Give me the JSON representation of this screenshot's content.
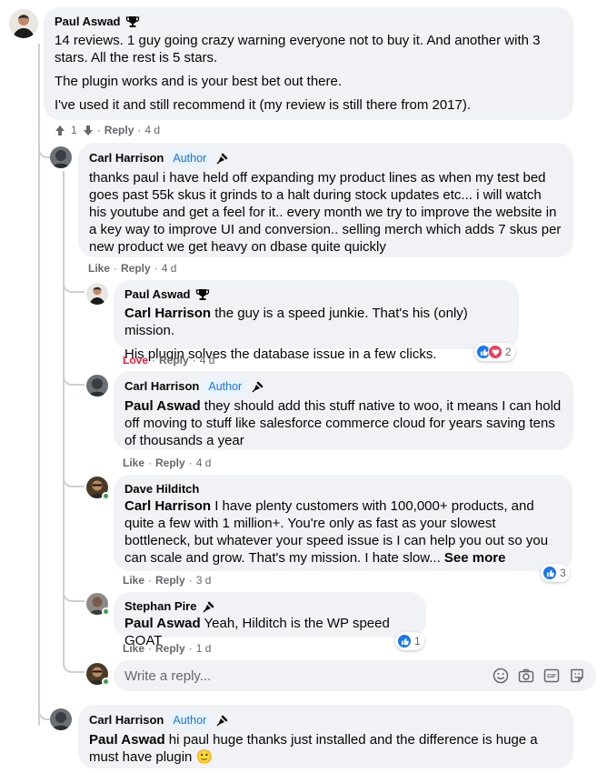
{
  "comments": {
    "c1": {
      "author": "Paul Aswad",
      "paragraphs": [
        "14 reviews. 1 guy going crazy warning everyone not to buy it. And another with 3 stars. All the rest is 5 stars.",
        "The plugin works and is your best bet out there.",
        "I've used it and still recommend it (my review is still there from 2017)."
      ],
      "votes": "1",
      "reply_label": "Reply",
      "time": "4 d"
    },
    "c2": {
      "author": "Carl Harrison",
      "badge": "Author",
      "text": "thanks paul i have held off expanding my product lines as when my test bed goes past 55k skus it grinds to a halt during stock updates etc... i will watch his youtube and get a feel for it.. every month we try to improve the website in a key way to improve UI and conversion.. selling merch which adds 7 skus per new product we get heavy on dbase quite quickly",
      "like_label": "Like",
      "reply_label": "Reply",
      "time": "4 d"
    },
    "c3": {
      "author": "Paul Aswad",
      "mention": "Carl Harrison",
      "text": " the guy is a speed junkie. That's his (only) mission.",
      "text2": "His plugin solves the database issue in a few clicks.",
      "love_label": "Love",
      "reply_label": "Reply",
      "time": "4 d",
      "reaction_count": "2"
    },
    "c4": {
      "author": "Carl Harrison",
      "badge": "Author",
      "mention": "Paul Aswad",
      "text": " they should add this stuff native to woo, it means I can hold off moving to stuff like salesforce commerce cloud for years saving tens of thousands a year",
      "like_label": "Like",
      "reply_label": "Reply",
      "time": "4 d"
    },
    "c5": {
      "author": "Dave Hilditch",
      "mention": "Carl Harrison",
      "text": " I have plenty customers with 100,000+ products, and quite a few with 1 million+. You're only as fast as your slowest bottleneck, but whatever your speed issue is I can help you out so you can scale and grow. That's my mission. I hate slow... ",
      "see_more": "See more",
      "like_label": "Like",
      "reply_label": "Reply",
      "time": "3 d",
      "reaction_count": "3"
    },
    "c6": {
      "author": "Stephan Pire",
      "mention": "Paul Aswad",
      "text": " Yeah, Hilditch is the WP speed GOAT",
      "like_label": "Like",
      "reply_label": "Reply",
      "time": "1 d",
      "reaction_count": "1"
    },
    "c7": {
      "author": "Carl Harrison",
      "badge": "Author",
      "mention": "Paul Aswad",
      "text": " hi paul huge thanks just installed and the difference is huge a must have plugin ",
      "emoji": "🙂"
    }
  },
  "reply_input": {
    "placeholder": "Write a reply..."
  },
  "colors": {
    "bubble": "#f0f2f5",
    "link_blue": "#1877f2",
    "love_red": "#e41e3f",
    "meta_gray": "#65676b"
  }
}
